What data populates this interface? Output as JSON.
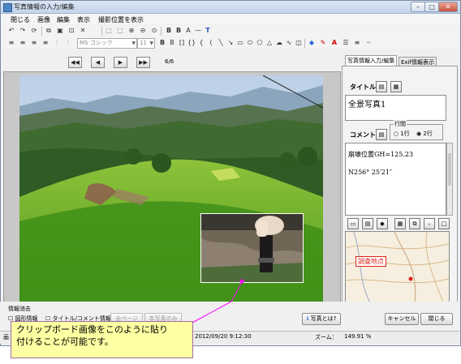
{
  "window": {
    "title": "写真情報の入力/編集"
  },
  "menu": [
    "閉じる",
    "画像",
    "編集",
    "表示",
    "撮影位置を表示"
  ],
  "toolbar2": {
    "font_name": "MS ゴシック",
    "font_size": "11"
  },
  "nav": {
    "first": "◀◀",
    "prev": "◀",
    "next": "▶",
    "last": "▶▶",
    "page": "6/6"
  },
  "panel": {
    "tabs": [
      "写真情報入力/編集",
      "Exif情報表示"
    ],
    "title_label": "タイトル",
    "title_value": "全景写真1",
    "comment_label": "コメント",
    "line_spacing": {
      "label": "行間",
      "options": [
        "1行",
        "2行"
      ],
      "selected": "2行"
    },
    "comment_lines": [
      "崩壊位置GH=125.23",
      "N256° 25′21″"
    ],
    "map_marker": "調査地点"
  },
  "bottom": {
    "group_label": "情報消去",
    "check_figure": "図形情報",
    "check_title": "タイトル/コメント情報",
    "btn_all_pages": "全ページ",
    "btn_this_page": "本写真のみ",
    "btn_help": "写真とは?",
    "btn_cancel": "キャンセル",
    "btn_close": "閉じる"
  },
  "status": {
    "left": "画",
    "datetime": "2012/09/20 9:12:30",
    "zoom_label": "ズーム：",
    "zoom_value": "149.91 %"
  },
  "callout": {
    "line1": "クリップボード画像をこのように貼り",
    "line2": "付けることが可能です。"
  },
  "colors": {
    "callout_bg": "#ffffa3",
    "callout_border": "#a06da8",
    "pointer": "#ff00ff",
    "marker": "#e0231b"
  }
}
